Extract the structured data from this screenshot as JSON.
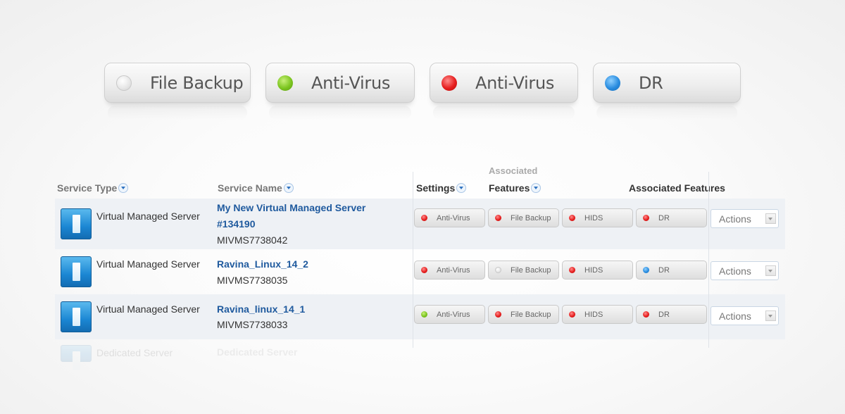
{
  "legend": [
    {
      "label": "File Backup",
      "status": "none"
    },
    {
      "label": "Anti-Virus",
      "status": "green"
    },
    {
      "label": "Anti-Virus",
      "status": "red"
    },
    {
      "label": "DR",
      "status": "blue"
    }
  ],
  "table": {
    "headers": {
      "service_type": "Service Type",
      "service_name": "Service Name",
      "settings": "Settings",
      "associated_top": "Associated",
      "features": "Features",
      "associated_features": "Associated Features"
    },
    "rows": [
      {
        "service_type": "Virtual Managed Server",
        "name_line1": "My New Virtual Managed Server",
        "name_line2": "#134190",
        "service_id": "MIVMS7738042",
        "features": [
          {
            "label": "Anti-Virus",
            "status": "red"
          },
          {
            "label": "File Backup",
            "status": "red"
          },
          {
            "label": "HIDS",
            "status": "red"
          },
          {
            "label": "DR",
            "status": "red"
          }
        ],
        "actions_label": "Actions"
      },
      {
        "service_type": "Virtual Managed Server",
        "name_line1": "Ravina_Linux_14_2",
        "name_line2": "",
        "service_id": "MIVMS7738035",
        "features": [
          {
            "label": "Anti-Virus",
            "status": "red"
          },
          {
            "label": "File Backup",
            "status": "none"
          },
          {
            "label": "HIDS",
            "status": "red"
          },
          {
            "label": "DR",
            "status": "blue"
          }
        ],
        "actions_label": "Actions"
      },
      {
        "service_type": "Virtual Managed Server",
        "name_line1": "Ravina_linux_14_1",
        "name_line2": "",
        "service_id": "MIVMS7738033",
        "features": [
          {
            "label": "Anti-Virus",
            "status": "green"
          },
          {
            "label": "File Backup",
            "status": "red"
          },
          {
            "label": "HIDS",
            "status": "red"
          },
          {
            "label": "DR",
            "status": "red"
          }
        ],
        "actions_label": "Actions"
      }
    ],
    "faded_row": {
      "service_type": "Dedicated Server",
      "service_name": "Dedicated Server"
    }
  },
  "status_colors": {
    "none": "#e2e2e2",
    "green": "#7cc520",
    "red": "#e61e1e",
    "blue": "#2a8de0"
  }
}
